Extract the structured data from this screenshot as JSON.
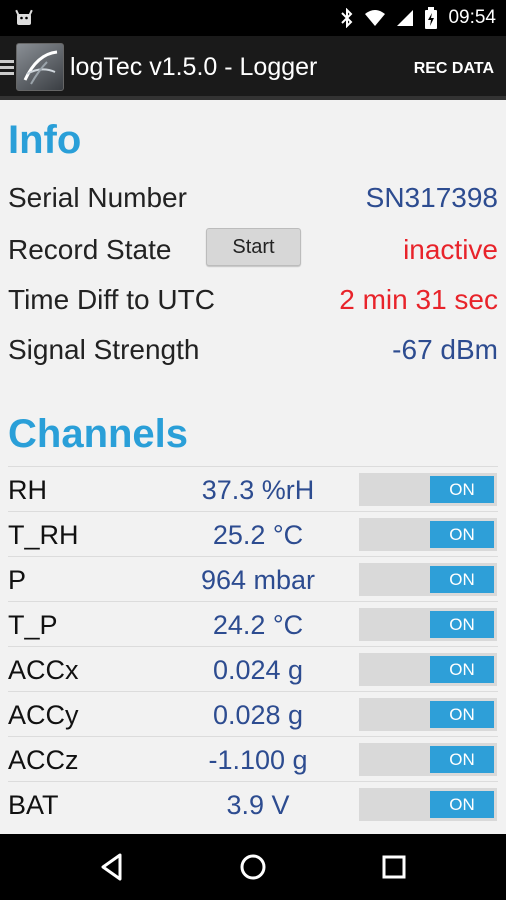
{
  "status_bar": {
    "time": "09:54",
    "icons": [
      "android-icon",
      "bluetooth-icon",
      "wifi-icon",
      "signal-icon",
      "battery-icon"
    ]
  },
  "action_bar": {
    "title": "logTec v1.5.0 - Logger",
    "action_label": "REC DATA"
  },
  "info": {
    "heading": "Info",
    "rows": [
      {
        "label": "Serial Number",
        "value": "SN317398"
      },
      {
        "label": "Record State",
        "button": "Start",
        "value": "inactive"
      },
      {
        "label": "Time Diff to UTC",
        "value": "2 min 31 sec"
      },
      {
        "label": "Signal Strength",
        "value": "-67 dBm"
      }
    ]
  },
  "channels": {
    "heading": "Channels",
    "items": [
      {
        "name": "RH",
        "value": "37.3 %rH",
        "toggle": "ON"
      },
      {
        "name": "T_RH",
        "value": "25.2 °C",
        "toggle": "ON"
      },
      {
        "name": "P",
        "value": "964 mbar",
        "toggle": "ON"
      },
      {
        "name": "T_P",
        "value": "24.2 °C",
        "toggle": "ON"
      },
      {
        "name": "ACCx",
        "value": "0.024 g",
        "toggle": "ON"
      },
      {
        "name": "ACCy",
        "value": "0.028 g",
        "toggle": "ON"
      },
      {
        "name": "ACCz",
        "value": "-1.100 g",
        "toggle": "ON"
      },
      {
        "name": "BAT",
        "value": "3.9 V",
        "toggle": "ON"
      }
    ]
  },
  "colors": {
    "accent": "#2a9fd8",
    "value_blue": "#2d4c90",
    "alert_red": "#e8232a"
  }
}
